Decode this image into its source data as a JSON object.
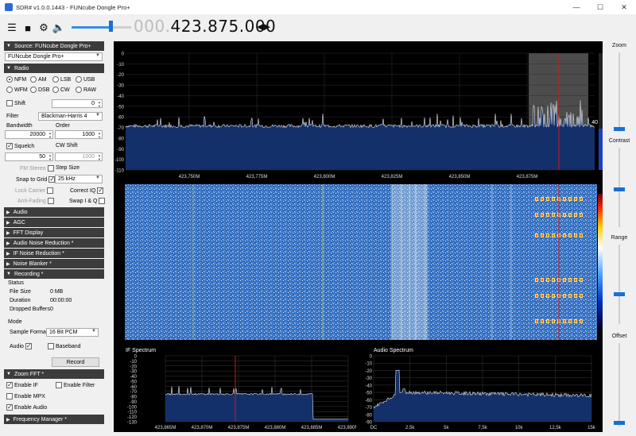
{
  "window": {
    "title": "SDR# v1.0.0.1443 - FUNcube Dongle Pro+"
  },
  "toolbar": {
    "frequency_dim": "000.",
    "frequency_main": "423.875.000"
  },
  "source": {
    "header": "Source: FUNcube Dongle Pro+",
    "device": "FUNcube Dongle Pro+"
  },
  "radio": {
    "header": "Radio",
    "modes": [
      "NFM",
      "AM",
      "LSB",
      "USB",
      "WFM",
      "DSB",
      "CW",
      "RAW"
    ],
    "shift_label": "Shift",
    "shift_value": "0",
    "filter_label": "Filter",
    "filter_value": "Blackman-Harris 4",
    "bandwidth_label": "Bandwidth",
    "bandwidth_value": "20000",
    "order_label": "Order",
    "order_value": "1000",
    "squelch_label": "Squelch",
    "squelch_value": "50",
    "cw_shift_label": "CW Shift",
    "cw_shift_value": "1000",
    "fm_stereo_label": "FM Stereo",
    "step_size_label": "Step Size",
    "snap_label": "Snap to Grid",
    "step_value": "25 kHz",
    "lock_carrier_label": "Lock Carrier",
    "correct_iq_label": "Correct IQ",
    "anti_fading_label": "Anti-Fading",
    "swap_iq_label": "Swap I & Q"
  },
  "sections": {
    "audio": "Audio",
    "agc": "AGC",
    "fft_display": "FFT Display",
    "audio_nr": "Audio Noise Reduction *",
    "if_nr": "IF Noise Reduction *",
    "noise_blanker": "Noise Blanker *",
    "recording": "Recording *",
    "zoom_fft": "Zoom FFT *",
    "frequency_manager": "Frequency Manager *"
  },
  "recording": {
    "status_label": "Status",
    "file_size_label": "File Size",
    "file_size_value": "0 MB",
    "duration_label": "Duration",
    "duration_value": "00:00:00",
    "dropped_label": "Dropped Buffers",
    "dropped_value": "0",
    "mode_label": "Mode",
    "sample_format_label": "Sample Format",
    "sample_format_value": "16 Bit PCM",
    "audio_label": "Audio",
    "baseband_label": "Baseband",
    "record_button": "Record"
  },
  "zoom_fft": {
    "enable_if": "Enable IF",
    "enable_filter": "Enable Filter",
    "enable_mpx": "Enable MPX",
    "enable_audio": "Enable Audio"
  },
  "right_panel": {
    "zoom": "Zoom",
    "contrast": "Contrast",
    "range": "Range",
    "offset": "Offset"
  },
  "spectrum": {
    "y_ticks": [
      "0",
      "-10",
      "-20",
      "-30",
      "-40",
      "-50",
      "-60",
      "-70",
      "-80",
      "-90",
      "-100",
      "-110"
    ],
    "x_ticks": [
      "423,750M",
      "423,775M",
      "423,800M",
      "423,825M",
      "423,850M",
      "423,875M"
    ],
    "gain_label": "40"
  },
  "if_spectrum": {
    "title": "IF Spectrum",
    "y_ticks": [
      "0",
      "-10",
      "-20",
      "-30",
      "-40",
      "-50",
      "-60",
      "-70",
      "-80",
      "-90",
      "-100",
      "-110",
      "-120",
      "-130"
    ],
    "x_ticks": [
      "423,865M",
      "423,870M",
      "423,875M",
      "423,880M",
      "423,885M",
      "423,890M"
    ]
  },
  "audio_spectrum": {
    "title": "Audio Spectrum",
    "y_ticks": [
      "0",
      "-10",
      "-20",
      "-30",
      "-40",
      "-50",
      "-60",
      "-70",
      "-80",
      "-90"
    ],
    "x_ticks": [
      "DC",
      "2,5k",
      "5k",
      "7,5k",
      "10k",
      "12,5k",
      "15k"
    ]
  },
  "colors": {
    "accent": "#1a6fd0",
    "spectrum_fill": "#13306a",
    "tuner_line": "#d01818",
    "section_header": "#3c3c3c"
  }
}
